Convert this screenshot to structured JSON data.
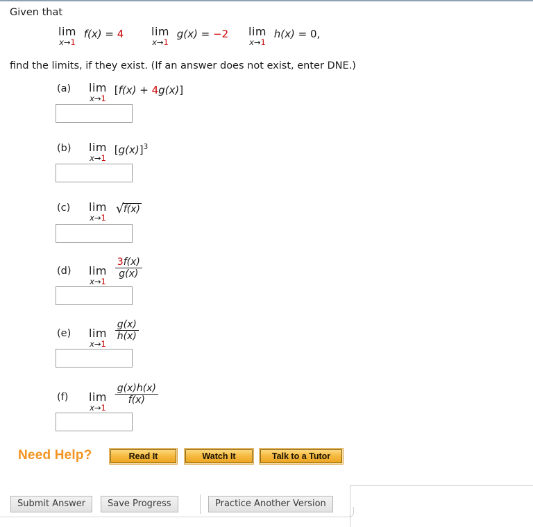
{
  "problem": {
    "intro": "Given that",
    "outro": "find the limits, if they exist. (If an answer does not exist, enter DNE.)",
    "givens": [
      {
        "op": "lim",
        "sub_var": "x",
        "sub_arrow": "→",
        "sub_value": "1",
        "func": "f(x)",
        "equals": "=",
        "value": "4",
        "value_color": "#cc0000",
        "trailing": ""
      },
      {
        "op": "lim",
        "sub_var": "x",
        "sub_arrow": "→",
        "sub_value": "1",
        "func": "g(x)",
        "equals": "=",
        "value": "−2",
        "value_color": "#cc0000",
        "trailing": ""
      },
      {
        "op": "lim",
        "sub_var": "x",
        "sub_arrow": "→",
        "sub_value": "1",
        "func": "h(x)",
        "equals": "=",
        "value": "0",
        "value_color": "#1a1a1a",
        "trailing": ","
      }
    ]
  },
  "parts": [
    {
      "label": "(a)",
      "op": "lim",
      "sub_var": "x",
      "sub_arrow": "→",
      "sub_value": "1",
      "expr_kind": "inline",
      "expr_open": "[",
      "expr_a": "f(x)",
      "expr_plus": " + ",
      "expr_coef": "4",
      "expr_b": "g(x)",
      "expr_close": "]",
      "answer_value": "",
      "answer_placeholder": ""
    },
    {
      "label": "(b)",
      "op": "lim",
      "sub_var": "x",
      "sub_arrow": "→",
      "sub_value": "1",
      "expr_kind": "power",
      "expr_open": "[",
      "expr_a": "g(x)",
      "expr_close": "]",
      "exponent": "3",
      "answer_value": "",
      "answer_placeholder": ""
    },
    {
      "label": "(c)",
      "op": "lim",
      "sub_var": "x",
      "sub_arrow": "→",
      "sub_value": "1",
      "expr_kind": "radical",
      "radical_sign": "√",
      "radicand": "f(x)",
      "answer_value": "",
      "answer_placeholder": ""
    },
    {
      "label": "(d)",
      "op": "lim",
      "sub_var": "x",
      "sub_arrow": "→",
      "sub_value": "1",
      "expr_kind": "fraction",
      "num_coef": "3",
      "num_rest": "f(x)",
      "denominator": "g(x)",
      "answer_value": "",
      "answer_placeholder": ""
    },
    {
      "label": "(e)",
      "op": "lim",
      "sub_var": "x",
      "sub_arrow": "→",
      "sub_value": "1",
      "expr_kind": "fraction",
      "num_coef": "",
      "num_rest": "g(x)",
      "denominator": "h(x)",
      "answer_value": "",
      "answer_placeholder": ""
    },
    {
      "label": "(f)",
      "op": "lim",
      "sub_var": "x",
      "sub_arrow": "→",
      "sub_value": "1",
      "expr_kind": "fraction",
      "num_coef": "",
      "num_rest": "g(x)h(x)",
      "denominator": "f(x)",
      "answer_value": "",
      "answer_placeholder": ""
    }
  ],
  "need_help": {
    "label": "Need Help?",
    "label_color": "#f2941f",
    "buttons": [
      {
        "text": "Read It"
      },
      {
        "text": "Watch It"
      },
      {
        "text": "Talk to a Tutor"
      }
    ]
  },
  "toolbar": {
    "submit_label": "Submit Answer",
    "save_label": "Save Progress",
    "practice_label": "Practice Another Version"
  },
  "colors": {
    "accent_red": "#cc0000",
    "accent_orange": "#f2941f",
    "text": "#1a1a1a",
    "top_rule": "#8fa0b4"
  }
}
